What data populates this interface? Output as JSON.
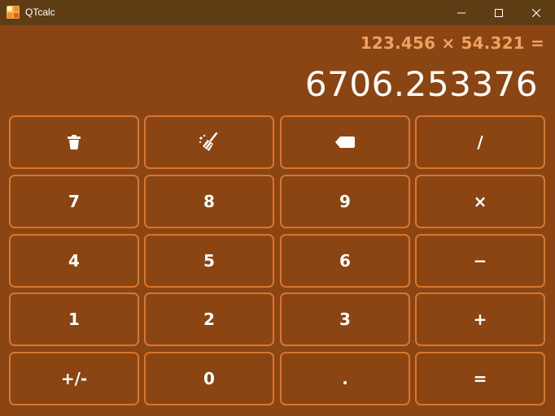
{
  "window": {
    "title": "QTcalc"
  },
  "display": {
    "expression": "123.456 × 54.321 =",
    "result": "6706.253376"
  },
  "keypad": {
    "rows": [
      [
        {
          "name": "clear-all-button",
          "icon": "trash-icon",
          "label": ""
        },
        {
          "name": "clear-entry-button",
          "icon": "broom-icon",
          "label": ""
        },
        {
          "name": "backspace-button",
          "icon": "backspace-icon",
          "label": ""
        },
        {
          "name": "divide-button",
          "label": "/"
        }
      ],
      [
        {
          "name": "digit-7-button",
          "label": "7"
        },
        {
          "name": "digit-8-button",
          "label": "8"
        },
        {
          "name": "digit-9-button",
          "label": "9"
        },
        {
          "name": "multiply-button",
          "label": "×"
        }
      ],
      [
        {
          "name": "digit-4-button",
          "label": "4"
        },
        {
          "name": "digit-5-button",
          "label": "5"
        },
        {
          "name": "digit-6-button",
          "label": "6"
        },
        {
          "name": "subtract-button",
          "label": "−"
        }
      ],
      [
        {
          "name": "digit-1-button",
          "label": "1"
        },
        {
          "name": "digit-2-button",
          "label": "2"
        },
        {
          "name": "digit-3-button",
          "label": "3"
        },
        {
          "name": "add-button",
          "label": "+"
        }
      ],
      [
        {
          "name": "negate-button",
          "label": "+/-"
        },
        {
          "name": "digit-0-button",
          "label": "0"
        },
        {
          "name": "decimal-button",
          "label": "."
        },
        {
          "name": "equals-button",
          "label": "="
        }
      ]
    ]
  },
  "colors": {
    "background": "#8a4513",
    "titlebar": "#5f3d14",
    "key_border": "#d9762c",
    "expression_text": "#f0a060",
    "result_text": "#ffffff"
  }
}
